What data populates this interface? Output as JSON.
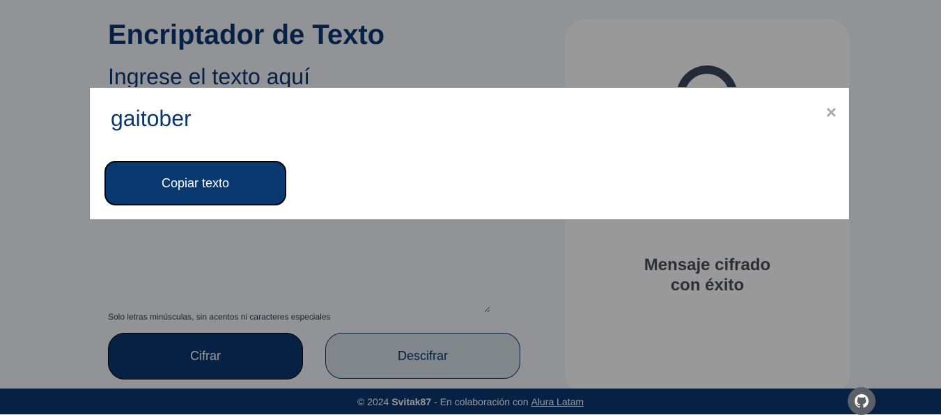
{
  "main": {
    "title": "Encriptador de Texto",
    "input_placeholder": "Ingrese el texto aquí",
    "hint": "Solo letras minúsculas, sin acentos ni caracteres especiales",
    "encrypt_label": "Cifrar",
    "decrypt_label": "Descifrar"
  },
  "result": {
    "message_line1": "Mensaje cifrado",
    "message_line2": "con éxito"
  },
  "footer": {
    "copyright": "© 2024",
    "author": "Svitak87",
    "collab_text": "- En colaboración con",
    "link_text": "Alura Latam"
  },
  "modal": {
    "text": "gaitober",
    "close_symbol": "×",
    "copy_label": "Copiar texto"
  },
  "icons": {
    "github": "github-icon"
  },
  "colors": {
    "brand": "#0a3871",
    "overlay": "rgba(0,0,0,0.4)"
  }
}
